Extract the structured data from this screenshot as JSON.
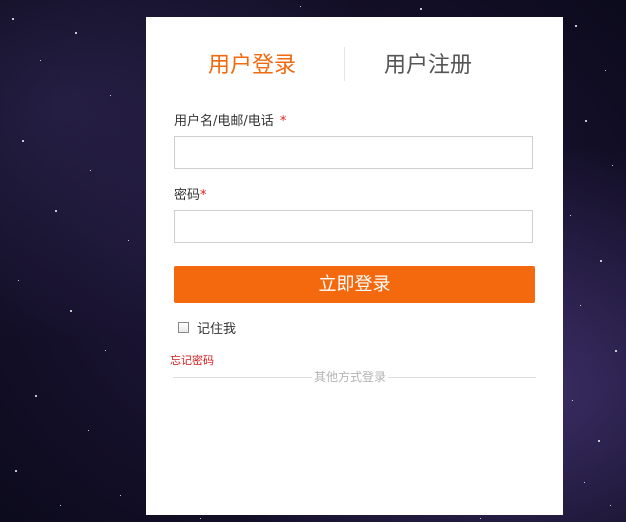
{
  "tabs": {
    "login": "用户登录",
    "register": "用户注册"
  },
  "form": {
    "username_label": "用户名/电邮/电话",
    "username_required_mark": "*",
    "username_value": "",
    "password_label": "密码",
    "password_required_mark": "*",
    "password_value": "",
    "submit_label": "立即登录",
    "remember_label": "记住我",
    "remember_checked": false,
    "forgot_label": "忘记密码",
    "other_methods_label": "其他方式登录"
  },
  "colors": {
    "accent": "#f4690e",
    "active_tab": "#f26a0e",
    "required_mark": "#e02020",
    "forgot_link": "#d01b1b"
  }
}
